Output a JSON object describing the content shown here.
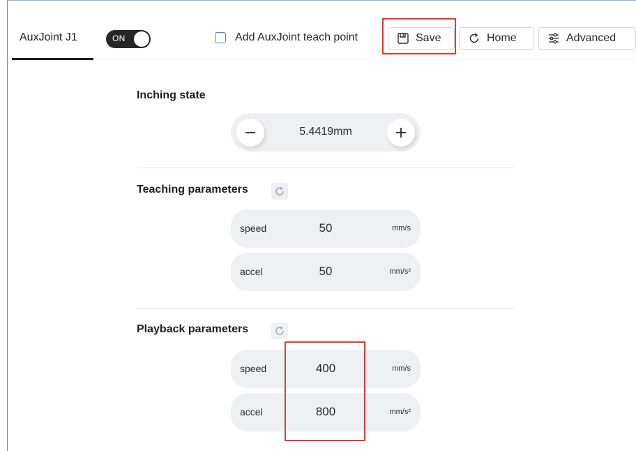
{
  "tab": {
    "label": "AuxJoint J1"
  },
  "toggle": {
    "label": "ON",
    "state": "on"
  },
  "teach_point": {
    "label": "Add AuxJoint teach point",
    "checked": false
  },
  "toolbar": {
    "save_label": "Save",
    "home_label": "Home",
    "advanced_label": "Advanced"
  },
  "inching": {
    "title": "Inching state",
    "value": "5.4419mm",
    "decrement_icon": "minus-icon",
    "increment_icon": "plus-icon"
  },
  "teaching": {
    "title": "Teaching parameters",
    "speed": {
      "label": "speed",
      "value": "50",
      "unit": "mm/s"
    },
    "accel": {
      "label": "accel",
      "value": "50",
      "unit": "mm/s²"
    }
  },
  "playback": {
    "title": "Playback parameters",
    "speed": {
      "label": "speed",
      "value": "400",
      "unit": "mm/s"
    },
    "accel": {
      "label": "accel",
      "value": "800",
      "unit": "mm/s²"
    }
  },
  "colors": {
    "highlight": "#e53935",
    "toggle_on": "#262626",
    "checkbox_border": "#4a86d8",
    "pill_bg": "#eef0f3"
  }
}
